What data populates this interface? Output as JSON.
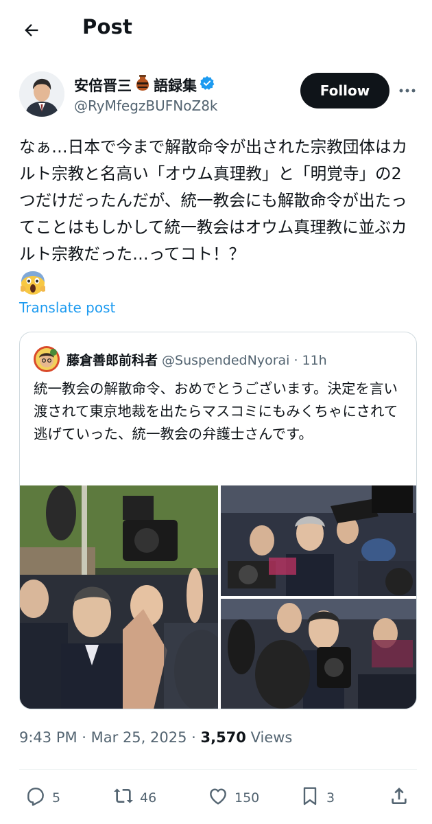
{
  "header": {
    "title": "Post",
    "back_icon": "arrow-left-icon"
  },
  "author": {
    "name": "安倍晋三",
    "name_suffix": "語録集",
    "name_emoji": "amphora-icon",
    "verified_icon": "verified-badge-icon",
    "handle": "@RyMfegzBUFNoZ8k",
    "follow_label": "Follow",
    "more_icon": "more-icon"
  },
  "post": {
    "text": "なぁ…日本で今まで解散命令が出された宗教団体はカルト宗教と名高い「オウム真理教」と「明覚寺」の2つだけだったんだが、統一教会にも解散命令が出たってことはもしかして統一教会はオウム真理教に並ぶカルト宗教だった…ってコト！？",
    "emoji": "screaming-face-icon",
    "translate_label": "Translate post"
  },
  "quote": {
    "name": "藤倉善郎前科者",
    "handle": "@SuspendedNyorai",
    "dot": "·",
    "time": "11h",
    "text": "統一教会の解散命令、おめでとうございます。決定を言い渡されて東京地裁を出たらマスコミにもみくちゃにされて逃げていった、統一教会の弁護士さんです。",
    "media": [
      "press-scrum-photo-1",
      "press-scrum-photo-2",
      "press-scrum-photo-3"
    ]
  },
  "meta": {
    "time": "9:43 PM · Mar 25, 2025 · ",
    "views_count": "3,570",
    "views_label": " Views"
  },
  "actions": {
    "reply": {
      "icon": "reply-icon",
      "count": "5"
    },
    "repost": {
      "icon": "repost-icon",
      "count": "46"
    },
    "like": {
      "icon": "heart-icon",
      "count": "150"
    },
    "bookmark": {
      "icon": "bookmark-icon",
      "count": "3"
    },
    "share": {
      "icon": "share-icon"
    }
  },
  "colors": {
    "accent": "#1d9bf0",
    "text": "#0f1419",
    "muted": "#536471",
    "border": "#cfd9de"
  }
}
